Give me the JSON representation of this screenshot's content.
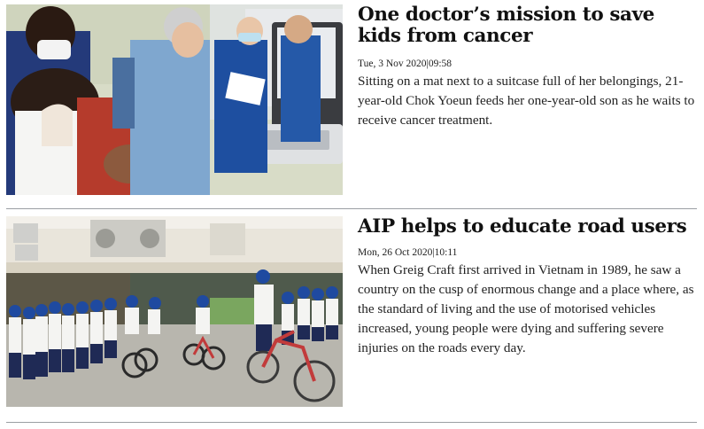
{
  "articles": [
    {
      "headline": "One doctor’s mission to save kids from cancer",
      "date": "Tue, 3 Nov 2020",
      "time": "09:58",
      "summary": "Sitting on a mat next to a suitcase full of her belongings, 21-year-old Chok Yoeun feeds her one-year-old son as he waits to receive cancer treatment.",
      "image_alt": "Doctor performing an ultrasound on a child in a hospital ward"
    },
    {
      "headline": "AIP helps to educate road users",
      "date": "Mon, 26 Oct 2020",
      "time": "10:11",
      "summary": "When Greig Craft first arrived in Vietnam in 1989, he saw a country on the cusp of enormous change and a place where, as the standard of living and the use of motorised vehicles increased, young people were dying and suffering severe injuries on the roads every day.",
      "image_alt": "Schoolchildren in helmets riding bicycles in a schoolyard"
    }
  ],
  "separator": "|",
  "colors": {
    "divider": "#9a9fa3",
    "headline": "#111111",
    "body_text": "#222222"
  }
}
